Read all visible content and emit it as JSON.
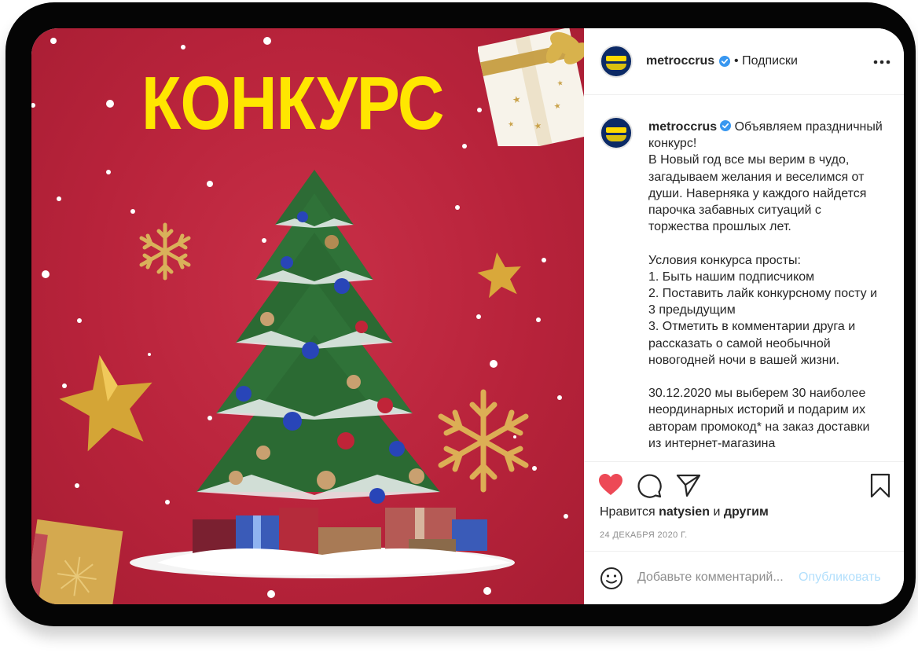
{
  "image": {
    "headline": "КОНКУРС"
  },
  "header": {
    "username": "metroccrus",
    "separator": "•",
    "follow_label": "Подписки",
    "more_icon": "more-horizontal-icon"
  },
  "caption": {
    "username": "metroccrus",
    "text": " Объявляем праздничный конкурс!\nВ Новый год все мы верим в чудо, загадываем желания и веселимся от души. Наверняка у каждого найдется парочка забавных ситуаций с торжества прошлых лет.\n\nУсловия конкурса просты:\n1. Быть нашим подписчиком\n2. Поставить лайк конкурсному посту и 3 предыдущим\n3. Отметить в комментарии друга и рассказать о самой необычной новогодней ночи в вашей жизни.\n\n30.12.2020 мы выберем 30 наиболее неординарных историй и подарим их авторам промокод* на заказ доставки из интернет-магазина"
  },
  "actions": {
    "like_icon": "heart-filled-icon",
    "comment_icon": "comment-icon",
    "share_icon": "send-icon",
    "save_icon": "bookmark-icon",
    "likes_prefix": "Нравится",
    "likes_user": "natysien",
    "likes_and": "и",
    "likes_others": "другим",
    "date": "24 ДЕКАБРЯ 2020 Г."
  },
  "comment": {
    "emoji_icon": "smiley-icon",
    "placeholder": "Добавьте комментарий...",
    "post_label": "Опубликовать"
  },
  "colors": {
    "like_red": "#ed4956",
    "verified_blue": "#3897f0",
    "image_red": "#b8233b",
    "headline_yellow": "#ffe600",
    "post_button_disabled": "#b2dffc"
  }
}
